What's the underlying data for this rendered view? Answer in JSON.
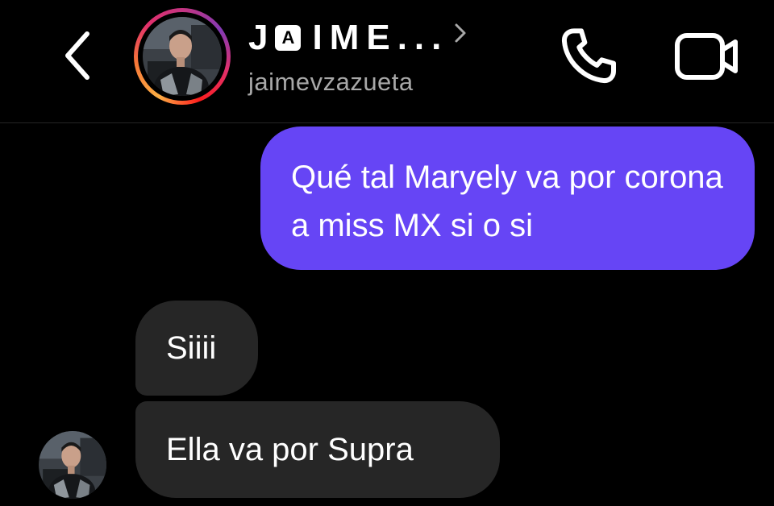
{
  "header": {
    "back_icon": "chevron-left-icon",
    "title_prefix": "J",
    "title_badge": "A",
    "title_suffix": "IME...",
    "title_chevron_icon": "chevron-right-icon",
    "username": "jaimevzazueta",
    "call_icon": "phone-icon",
    "video_icon": "video-camera-icon",
    "story_ring_colors": [
      "#fcaf45",
      "#f77737",
      "#e1306c",
      "#c13584",
      "#833ab4"
    ]
  },
  "messages": [
    {
      "direction": "sent",
      "text": "Qué tal Maryely va por corona a miss MX si o si",
      "color": "#6645f5"
    },
    {
      "direction": "received",
      "text": "Siiii",
      "color": "#262626"
    },
    {
      "direction": "received",
      "text": "Ella va por Supra",
      "color": "#262626"
    }
  ],
  "colors": {
    "background": "#000000",
    "sent_bubble": "#6645f5",
    "received_bubble": "#262626",
    "username_text": "#a8a8a8"
  }
}
